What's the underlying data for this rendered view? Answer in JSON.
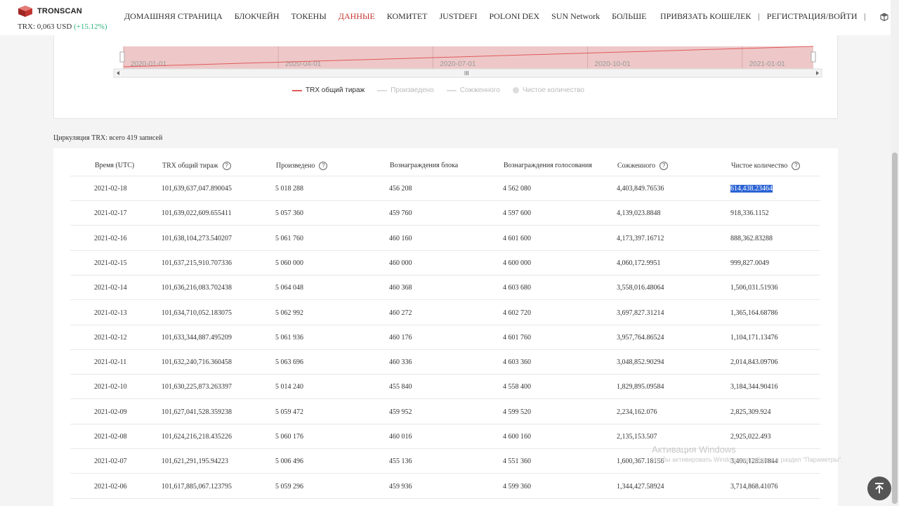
{
  "header": {
    "logo_text": "TRONSCAN",
    "price_label": "TRX: 0,063 USD",
    "price_change": "(+15.12%)",
    "nav": [
      {
        "label": "ДОМАШНЯЯ СТРАНИЦА",
        "active": false
      },
      {
        "label": "БЛОКЧЕЙН",
        "active": false
      },
      {
        "label": "ТОКЕНЫ",
        "active": false
      },
      {
        "label": "ДАННЫЕ",
        "active": true
      },
      {
        "label": "КОМИТЕТ",
        "active": false
      },
      {
        "label": "JUSTDEFI",
        "active": false
      },
      {
        "label": "POLONI DEX",
        "active": false
      },
      {
        "label": "SUN Network",
        "active": false
      },
      {
        "label": "БОЛЬШЕ",
        "active": false
      }
    ],
    "connect_wallet": "ПРИВЯЗАТЬ КОШЕЛЕК",
    "separator": "|",
    "register_login": "РЕГИСТРАЦИЯ/ВОЙТИ"
  },
  "chart_data": {
    "type": "line",
    "x": [
      "2020-01-01",
      "2020-04-01",
      "2020-07-01",
      "2020-10-01",
      "2021-01-01"
    ],
    "series": [
      {
        "name": "TRX общий тираж",
        "color": "#e05a5a",
        "visible": true
      },
      {
        "name": "Произведено",
        "visible": false
      },
      {
        "name": "Сожженного",
        "visible": false
      },
      {
        "name": "Чистое количество",
        "visible": false
      }
    ],
    "legend_position": "bottom",
    "zoom_handle_label": "III"
  },
  "caption": "Циркуляция TRX: всего 419 записей",
  "table": {
    "columns": [
      {
        "label": "Время (UTC)",
        "help": false
      },
      {
        "label": "TRX общий тираж",
        "help": true
      },
      {
        "label": "Произведено",
        "help": true
      },
      {
        "label": "Вознаграждения блока",
        "help": false
      },
      {
        "label": "Вознаграждения голосования",
        "help": false
      },
      {
        "label": "Сожженного",
        "help": true
      },
      {
        "label": "Чистое количество",
        "help": true
      }
    ],
    "help_glyph": "?",
    "rows": [
      [
        "2021-02-18",
        "101,639,637,047.890045",
        "5 018 288",
        "456 208",
        "4 562 080",
        "4,403,849.76536",
        "614,438.23464"
      ],
      [
        "2021-02-17",
        "101,639,022,609.655411",
        "5 057 360",
        "459 760",
        "4 597 600",
        "4,139,023.8848",
        "918,336.1152"
      ],
      [
        "2021-02-16",
        "101,638,104,273.540207",
        "5 061 760",
        "460 160",
        "4 601 600",
        "4,173,397.16712",
        "888,362.83288"
      ],
      [
        "2021-02-15",
        "101,637,215,910.707336",
        "5 060 000",
        "460 000",
        "4 600 000",
        "4,060,172.9951",
        "999,827.0049"
      ],
      [
        "2021-02-14",
        "101,636,216,083.702438",
        "5 064 048",
        "460 368",
        "4 603 680",
        "3,558,016.48064",
        "1,506,031.51936"
      ],
      [
        "2021-02-13",
        "101,634,710,052.183075",
        "5 062 992",
        "460 272",
        "4 602 720",
        "3,697,827.31214",
        "1,365,164.68786"
      ],
      [
        "2021-02-12",
        "101,633,344,887.495209",
        "5 061 936",
        "460 176",
        "4 601 760",
        "3,957,764.86524",
        "1,104,171.13476"
      ],
      [
        "2021-02-11",
        "101,632,240,716.360458",
        "5 063 696",
        "460 336",
        "4 603 360",
        "3,048,852.90294",
        "2,014,843.09706"
      ],
      [
        "2021-02-10",
        "101,630,225,873.263397",
        "5 014 240",
        "455 840",
        "4 558 400",
        "1,829,895.09584",
        "3,184,344.90416"
      ],
      [
        "2021-02-09",
        "101,627,041,528.359238",
        "5 059 472",
        "459 952",
        "4 599 520",
        "2,234,162.076",
        "2,825,309.924"
      ],
      [
        "2021-02-08",
        "101,624,216,218.435226",
        "5 060 176",
        "460 016",
        "4 600 160",
        "2,135,153.507",
        "2,925,022.493"
      ],
      [
        "2021-02-07",
        "101,621,291,195.94223",
        "5 006 496",
        "455 136",
        "4 551 360",
        "1,600,367.18156",
        "3,406,128.81844"
      ],
      [
        "2021-02-06",
        "101,617,885,067.123795",
        "5 059 296",
        "459 936",
        "4 599 360",
        "1,344,427.58924",
        "3,714,868.41076"
      ]
    ]
  },
  "watermark": {
    "title": "Активация Windows",
    "text": "Чтобы активировать Windows, перейдите в раздел \"Параметры\"."
  },
  "colors": {
    "accent": "#c23631",
    "positive": "#2bb27a",
    "series_line": "#e05a5a",
    "chart_fill": "#eec8c8",
    "selection": "#2a63d4"
  }
}
